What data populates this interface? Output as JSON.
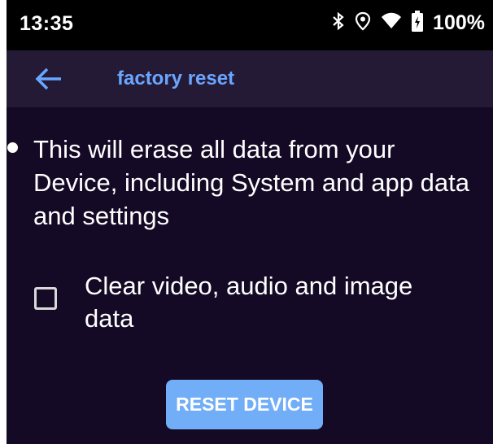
{
  "status_bar": {
    "time": "13:35",
    "battery": "100%",
    "icons": [
      "bluetooth-icon",
      "location-icon",
      "wifi-icon",
      "battery-icon"
    ]
  },
  "app_bar": {
    "back_icon": "arrow-left-icon",
    "title": "factory reset"
  },
  "content": {
    "warning": "This will erase all data from your Device, including System and app data and settings",
    "clear_media_option": {
      "label": "Clear video, audio and image data",
      "checked": false
    },
    "reset_button": "RESET DEVICE"
  },
  "colors": {
    "background": "#150a26",
    "app_bar": "#241a36",
    "accent": "#6aa6ff",
    "button": "#72aef8"
  }
}
